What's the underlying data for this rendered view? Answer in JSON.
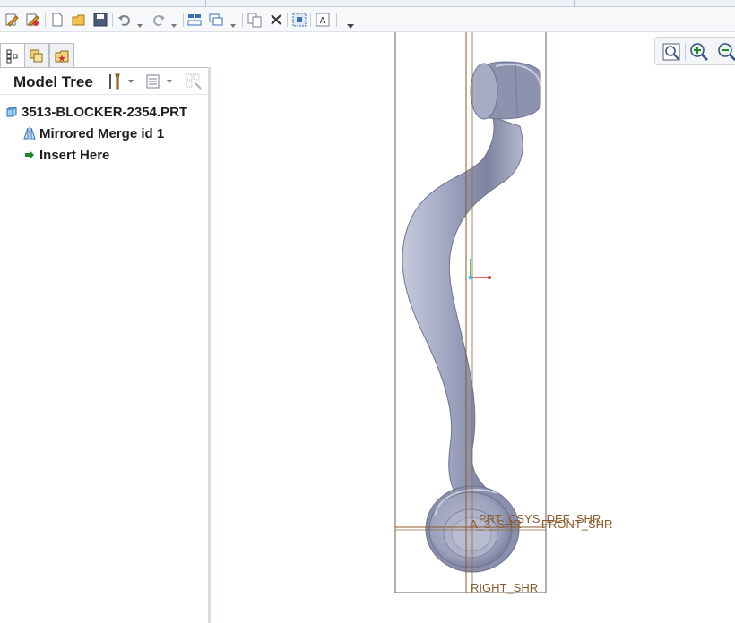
{
  "toolbar": {
    "buttons": [
      "regenerate-icon",
      "regenerate-manager-icon",
      "new-icon",
      "open-icon",
      "save-icon",
      "undo-icon",
      "redo-icon",
      "windows-icon",
      "switch-window-icon",
      "copy-icon",
      "close-window-icon",
      "select-box-icon",
      "annotation-icon",
      "customize-dropdown-icon"
    ]
  },
  "navigator": {
    "tabs": [
      "model-tree-tab",
      "layers-tab",
      "favorites-tab"
    ]
  },
  "model_tree": {
    "title": "Model Tree",
    "items": [
      {
        "label": "3513-BLOCKER-2354.PRT",
        "icon": "part-icon"
      },
      {
        "label": "Mirrored Merge id 1",
        "icon": "mirror-merge-icon"
      },
      {
        "label": "Insert Here",
        "icon": "insert-arrow-icon"
      }
    ]
  },
  "datums": {
    "csys": "PRT_CSYS_DEF_SHR",
    "top": "A_3_SHR",
    "front": "FRONT_SHR",
    "right": "RIGHT_SHR"
  },
  "colors": {
    "part_fill": "#9ba1bd",
    "datum_line": "#8b5a2b",
    "accent": "#2a6fbf"
  }
}
